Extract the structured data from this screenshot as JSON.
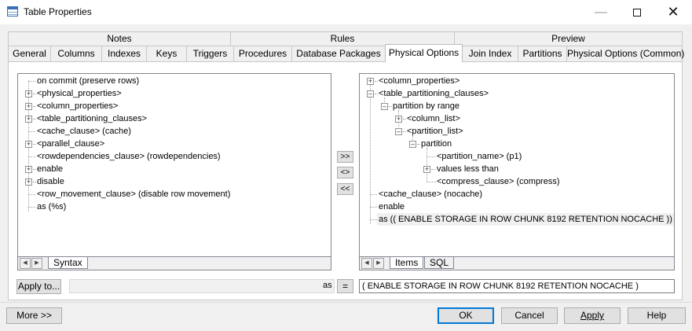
{
  "window": {
    "title": "Table Properties"
  },
  "tab_headers": [
    "Notes",
    "Rules",
    "Preview"
  ],
  "tabs": [
    "General",
    "Columns",
    "Indexes",
    "Keys",
    "Triggers",
    "Procedures",
    "Database Packages",
    "Physical Options",
    "Join Index",
    "Partitions",
    "Physical Options (Common)"
  ],
  "active_tab": "Physical Options",
  "left_tree": [
    "on commit (preserve rows)",
    "<physical_properties>",
    "<column_properties>",
    "<table_partitioning_clauses>",
    "<cache_clause> (cache)",
    "<parallel_clause>",
    "<rowdependencies_clause> (rowdependencies)",
    "enable",
    "disable",
    "<row_movement_clause> (disable row movement)",
    "as (%s)"
  ],
  "left_tabs": [
    "Syntax"
  ],
  "move_buttons": [
    ">>",
    "<>",
    "<<"
  ],
  "right_tree": [
    "<column_properties>",
    "<table_partitioning_clauses>",
    "partition by range",
    "<column_list>",
    "<partition_list>",
    "partition",
    "<partition_name> (p1)",
    "values less than",
    "<compress_clause> (compress)",
    "<cache_clause> (nocache)",
    "enable",
    "as (( ENABLE STORAGE IN ROW CHUNK 8192 RETENTION NOCACHE ))"
  ],
  "right_tabs": [
    "Items",
    "SQL"
  ],
  "apply_to_label": "Apply to...",
  "as_label": "as",
  "equals_label": "=",
  "value_field": "( ENABLE STORAGE IN ROW CHUNK 8192 RETENTION NOCACHE )",
  "buttons": {
    "more": "More >>",
    "ok": "OK",
    "cancel": "Cancel",
    "apply": "Apply",
    "help": "Help"
  }
}
